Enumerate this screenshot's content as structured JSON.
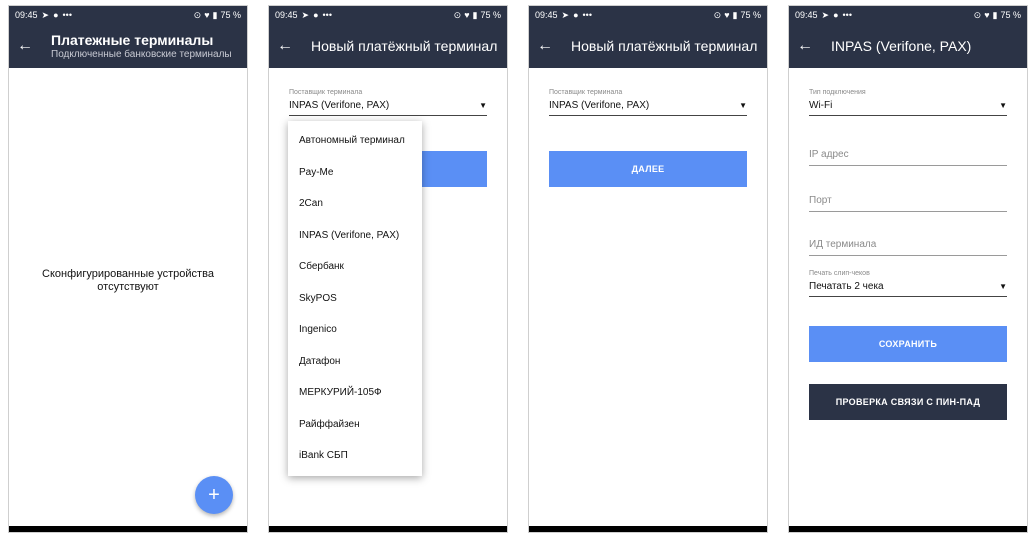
{
  "status_bar": {
    "time": "09:45",
    "battery": "75 %"
  },
  "screen1": {
    "title": "Платежные терминалы",
    "subtitle": "Подключенные банковские терминалы",
    "empty_message": "Сконфигурированные устройства отсутствуют",
    "fab_label": "+"
  },
  "screen2": {
    "title": "Новый платёжный терминал",
    "provider_label": "Поставщик терминала",
    "provider_value": "INPAS (Verifone, PAX)",
    "dropdown_options": [
      "Автономный терминал",
      "Pay-Me",
      "2Can",
      "INPAS (Verifone, PAX)",
      "Сбербанк",
      "SkyPOS",
      "Ingenico",
      "Датафон",
      "МЕРКУРИЙ-105Ф",
      "Райффайзен",
      "iBank СБП"
    ]
  },
  "screen3": {
    "title": "Новый платёжный терминал",
    "provider_label": "Поставщик терминала",
    "provider_value": "INPAS (Verifone, PAX)",
    "next_button": "ДАЛЕЕ"
  },
  "screen4": {
    "title": "INPAS (Verifone, PAX)",
    "connection_label": "Тип подключения",
    "connection_value": "Wi-Fi",
    "ip_placeholder": "IP адрес",
    "port_placeholder": "Порт",
    "terminal_id_placeholder": "ИД терминала",
    "receipt_label": "Печать слип-чеков",
    "receipt_value": "Печатать 2 чека",
    "save_button": "СОХРАНИТЬ",
    "check_button": "ПРОВЕРКА СВЯЗИ С ПИН-ПАД"
  },
  "colors": {
    "appbar": "#2b3346",
    "accent": "#5a8ff5"
  },
  "icons": {
    "back": "arrow-left-icon",
    "dropdown": "caret-down-icon",
    "add": "plus-icon"
  }
}
